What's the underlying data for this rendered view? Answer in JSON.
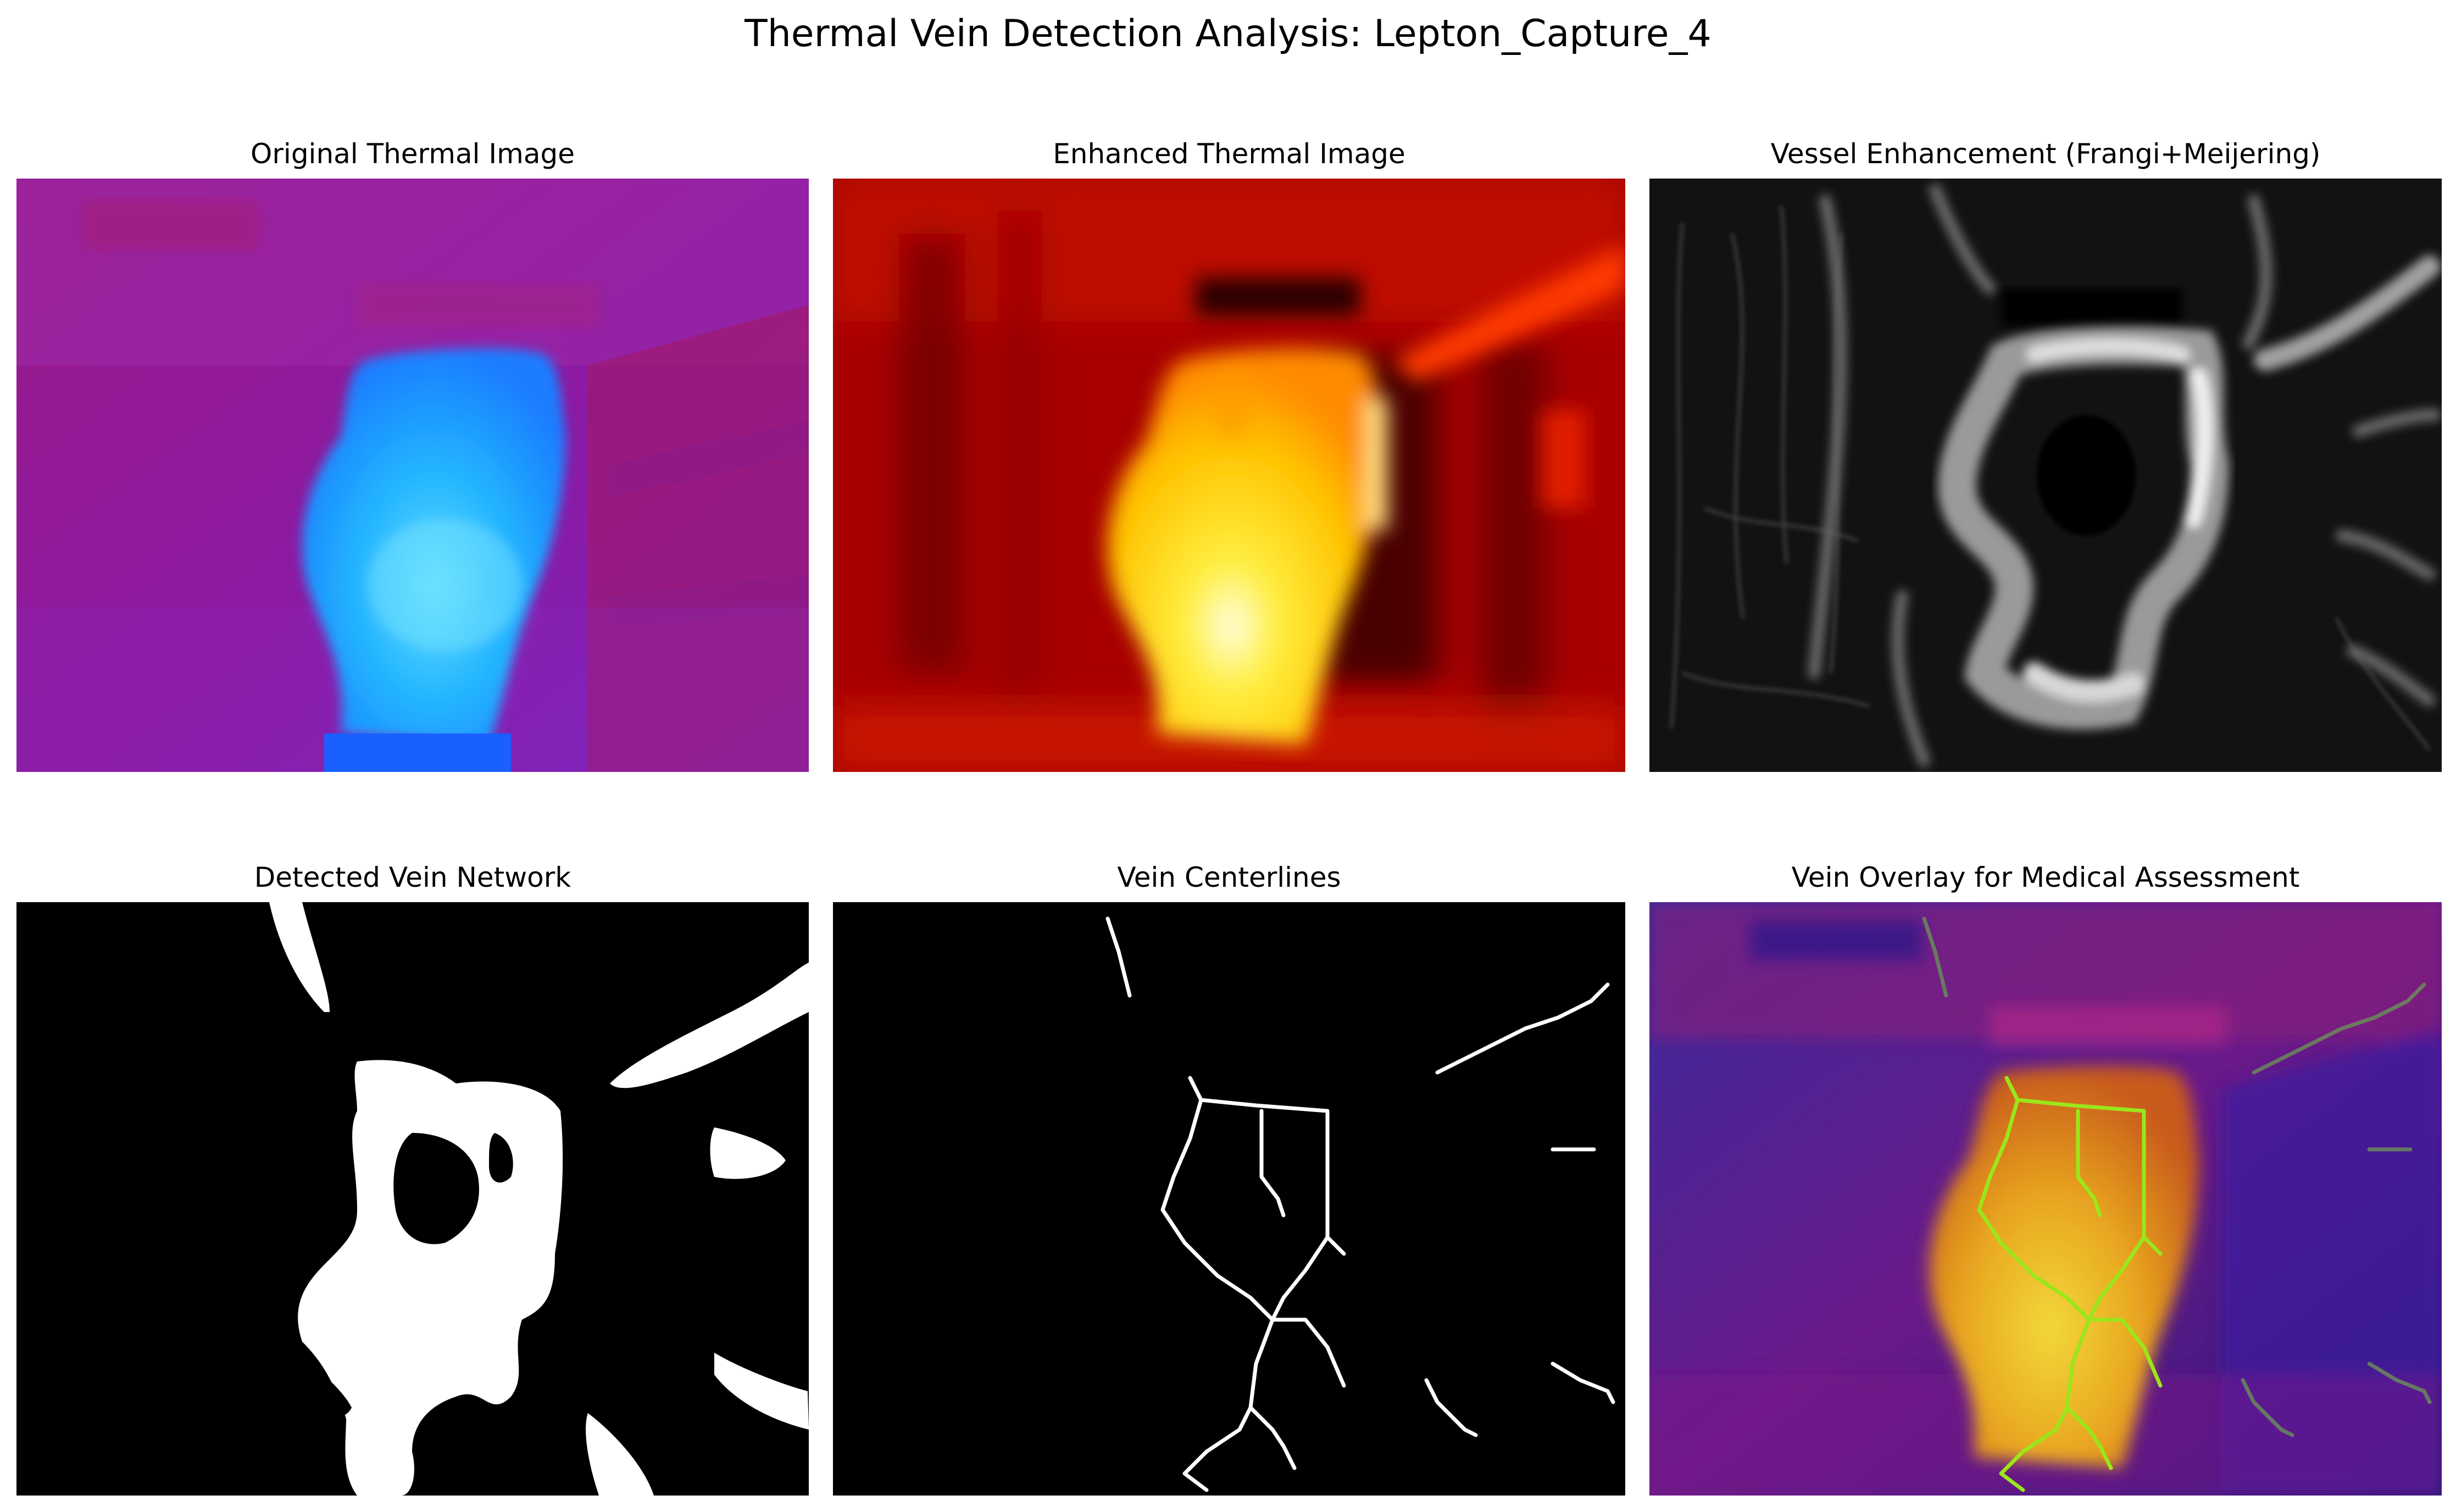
{
  "figure": {
    "title": "Thermal Vein Detection Analysis: Lepton_Capture_4"
  },
  "panels": [
    {
      "id": "original",
      "title": "Original Thermal Image"
    },
    {
      "id": "enhanced",
      "title": "Enhanced Thermal Image"
    },
    {
      "id": "vessel",
      "title": "Vessel Enhancement (Frangi+Meijering)"
    },
    {
      "id": "network",
      "title": "Detected Vein Network"
    },
    {
      "id": "centerlines",
      "title": "Vein Centerlines"
    },
    {
      "id": "overlay",
      "title": "Vein Overlay for Medical Assessment"
    }
  ],
  "colors": {
    "background": "#ffffff",
    "original_bg": "#8a1aa0",
    "original_hand": "#1f9bff",
    "enhanced_bg": "#9a0000",
    "enhanced_hand": "#ffd21a",
    "vessel_bg": "#0a0a0a",
    "vessel_ridge": "#d8d8d8",
    "network_bg": "#000000",
    "network_fg": "#ffffff",
    "centerline": "#ffffff",
    "overlay_bg": "#4a1a8a",
    "overlay_hand": "#e38a1a",
    "overlay_vein": "#9be61a"
  }
}
